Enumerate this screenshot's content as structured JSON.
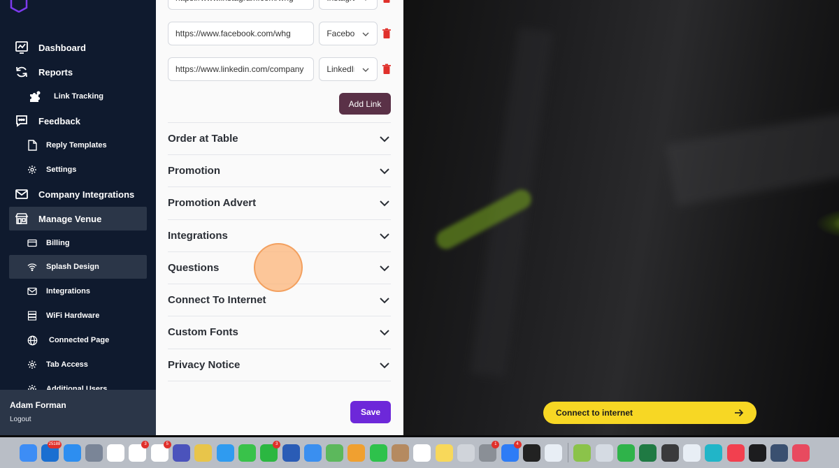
{
  "sidebar": {
    "items": [
      {
        "label": "Dashboard",
        "icon": "chart-icon",
        "level": "main"
      },
      {
        "label": "Reports",
        "icon": "refresh-icon",
        "level": "main"
      },
      {
        "label": "Link Tracking",
        "icon": "puzzle-icon",
        "level": "sub"
      },
      {
        "label": "Feedback",
        "icon": "chat-bubble-icon",
        "level": "main"
      },
      {
        "label": "Reply Templates",
        "icon": "document-icon",
        "level": "sub"
      },
      {
        "label": "Settings",
        "icon": "gear-icon",
        "level": "sub"
      },
      {
        "label": "Company Integrations",
        "icon": "mail-icon",
        "level": "main"
      },
      {
        "label": "Manage Venue",
        "icon": "store-icon",
        "level": "main",
        "active": true
      },
      {
        "label": "Billing",
        "icon": "credit-card-icon",
        "level": "sub"
      },
      {
        "label": "Splash Design",
        "icon": "wifi-icon",
        "level": "sub",
        "active": true
      },
      {
        "label": "Integrations",
        "icon": "mail-icon",
        "level": "sub"
      },
      {
        "label": "WiFi Hardware",
        "icon": "server-icon",
        "level": "sub"
      },
      {
        "label": "Connected Page",
        "icon": "globe-icon",
        "level": "sub"
      },
      {
        "label": "Tab Access",
        "icon": "gear-icon",
        "level": "sub"
      },
      {
        "label": "Additional Users",
        "icon": "gear-icon",
        "level": "sub"
      }
    ],
    "user": {
      "name": "Adam Forman",
      "logout": "Logout"
    }
  },
  "links": {
    "rows": [
      {
        "url": "https://www.instagram.com/whg",
        "type": "Instagram"
      },
      {
        "url": "https://www.facebook.com/whg",
        "type": "Facebook"
      },
      {
        "url": "https://www.linkedin.com/company",
        "type": "LinkedIn"
      }
    ],
    "add_label": "Add Link"
  },
  "accordion": [
    {
      "title": "Order at Table"
    },
    {
      "title": "Promotion"
    },
    {
      "title": "Promotion Advert"
    },
    {
      "title": "Integrations"
    },
    {
      "title": "Questions"
    },
    {
      "title": "Connect To Internet"
    },
    {
      "title": "Custom Fonts"
    },
    {
      "title": "Privacy Notice"
    }
  ],
  "save_label": "Save",
  "preview": {
    "connect_label": "Connect to internet"
  },
  "colors": {
    "sidebar": "#0f1a2e",
    "active": "#2b3648",
    "add_link": "#5a3147",
    "save": "#6d28d9",
    "connect": "#f7d724",
    "trash": "#e0302b"
  },
  "dock": {
    "icons": [
      {
        "name": "finder-icon",
        "color": "#3d8df5"
      },
      {
        "name": "outlook-icon",
        "color": "#1a6fd1",
        "badge": "25188"
      },
      {
        "name": "app-store-icon",
        "color": "#2d8ef0"
      },
      {
        "name": "launchpad-icon",
        "color": "#7a8597"
      },
      {
        "name": "calendar-icon",
        "color": "#ffffff",
        "badge": ""
      },
      {
        "name": "jira-icon",
        "color": "#ffffff",
        "badge": "3"
      },
      {
        "name": "slack-icon",
        "color": "#ffffff",
        "badge": "5"
      },
      {
        "name": "teams-icon",
        "color": "#4b53bc"
      },
      {
        "name": "chrome-icon",
        "color": "#e8c54a"
      },
      {
        "name": "safari-icon",
        "color": "#2f9bf0"
      },
      {
        "name": "messages-icon",
        "color": "#39c24a"
      },
      {
        "name": "whatsapp-icon",
        "color": "#2bb741",
        "badge": "3"
      },
      {
        "name": "word-icon",
        "color": "#2a5cb6"
      },
      {
        "name": "mail-app-icon",
        "color": "#3a8ff0"
      },
      {
        "name": "maps-icon",
        "color": "#5cb85c"
      },
      {
        "name": "photos-icon",
        "color": "#f0a030"
      },
      {
        "name": "facetime-icon",
        "color": "#2ec24c"
      },
      {
        "name": "contacts-icon",
        "color": "#b58a60"
      },
      {
        "name": "reminders-icon",
        "color": "#ffffff"
      },
      {
        "name": "notes-icon",
        "color": "#f8d85a"
      },
      {
        "name": "iphone-mirroring-icon",
        "color": "#d0d4da"
      },
      {
        "name": "system-settings-icon",
        "color": "#8a8f96",
        "badge": "1"
      },
      {
        "name": "zoom-icon",
        "color": "#2d7cf6",
        "badge": "4"
      },
      {
        "name": "bolt-app-icon",
        "color": "#222222"
      },
      {
        "name": "docker-icon",
        "color": "#e8eef5"
      },
      {
        "name": "webex-icon",
        "color": "#8bc34a"
      },
      {
        "name": "preview-icon",
        "color": "#d5dbe3"
      },
      {
        "name": "numbers-icon",
        "color": "#2fb34a"
      },
      {
        "name": "excel-icon",
        "color": "#1f7a43"
      },
      {
        "name": "calculator-icon",
        "color": "#3a3a3c"
      },
      {
        "name": "keychain-icon",
        "color": "#e8eef5"
      },
      {
        "name": "canva-icon",
        "color": "#21b5c8"
      },
      {
        "name": "music-icon",
        "color": "#f2404f"
      },
      {
        "name": "terminal-icon",
        "color": "#1c1c1e"
      },
      {
        "name": "quicktime-icon",
        "color": "#3a5070"
      },
      {
        "name": "scrivener-icon",
        "color": "#e84a5f"
      }
    ]
  }
}
